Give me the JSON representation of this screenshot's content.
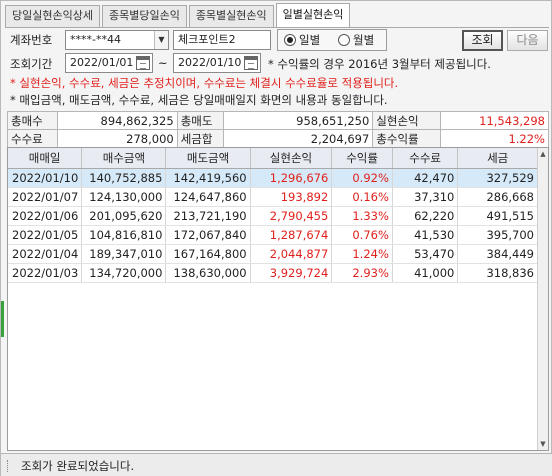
{
  "tabs": [
    {
      "label": "당일실현손익상세",
      "active": false
    },
    {
      "label": "종목별당일손익",
      "active": false
    },
    {
      "label": "종목별실현손익",
      "active": false
    },
    {
      "label": "일별실현손익",
      "active": true
    }
  ],
  "form": {
    "account_label": "계좌번호",
    "account_value": "****-**44",
    "account_name": "체크포인트2",
    "period_label": "조회기간",
    "date_from": "2022/01/01",
    "date_sep": "~",
    "date_to": "2022/01/10",
    "radio_daily": "일별",
    "radio_monthly": "월별",
    "selected": "daily",
    "search_button": "조회",
    "next_button": "다음",
    "note_period": "* 수익률의 경우 2016년 3월부터 제공됩니다."
  },
  "notes": {
    "red": "* 실현손익, 수수료, 세금은 추정치이며, 수수료는 체결시 수수료율로 적용됩니다.",
    "black": "* 매입금액, 매도금액, 수수료, 세금은 당일매매일지 화면의 내용과 동일합니다."
  },
  "summary": {
    "total_buy_label": "총매수",
    "total_buy": "894,862,325",
    "total_sell_label": "총매도",
    "total_sell": "958,651,250",
    "realized_label": "실현손익",
    "realized": "11,543,298",
    "fee_label": "수수료",
    "fee": "278,000",
    "tax_label": "세금합",
    "tax": "2,204,697",
    "return_label": "총수익률",
    "return": "1.22%"
  },
  "grid": {
    "headers": [
      "매매일",
      "매수금액",
      "매도금액",
      "실현손익",
      "수익률",
      "수수료",
      "세금"
    ],
    "rows": [
      [
        "2022/01/10",
        "140,752,885",
        "142,419,560",
        "1,296,676",
        "0.92%",
        "42,470",
        "327,529"
      ],
      [
        "2022/01/07",
        "124,130,000",
        "124,647,860",
        "193,892",
        "0.16%",
        "37,310",
        "286,668"
      ],
      [
        "2022/01/06",
        "201,095,620",
        "213,721,190",
        "2,790,455",
        "1.33%",
        "62,220",
        "491,515"
      ],
      [
        "2022/01/05",
        "104,816,810",
        "172,067,840",
        "1,287,674",
        "0.76%",
        "41,530",
        "395,700"
      ],
      [
        "2022/01/04",
        "189,347,010",
        "167,164,800",
        "2,044,877",
        "1.24%",
        "53,470",
        "384,449"
      ],
      [
        "2022/01/03",
        "134,720,000",
        "138,630,000",
        "3,929,724",
        "2.93%",
        "41,000",
        "318,836"
      ]
    ]
  },
  "status": {
    "text": "조회가 완료되었습니다."
  },
  "colors": {
    "profit": "#e0201c",
    "selected_row": "#d6e9f8",
    "header_bg": "#e8ecf2"
  },
  "icons": {
    "calendar": "calendar-icon",
    "combo": "chevron-down-icon",
    "scroll_up": "scroll-up-icon",
    "scroll_down": "scroll-down-icon"
  }
}
